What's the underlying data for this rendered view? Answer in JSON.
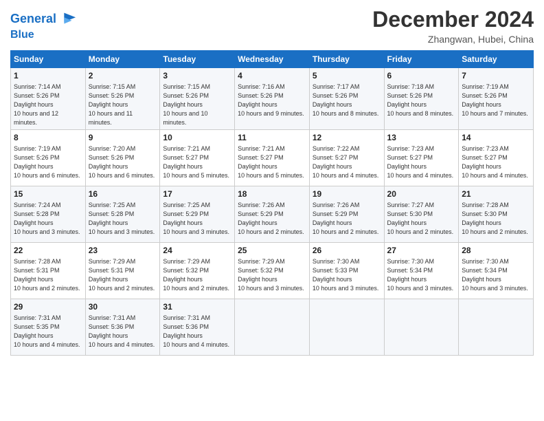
{
  "header": {
    "logo_line1": "General",
    "logo_line2": "Blue",
    "month": "December 2024",
    "location": "Zhangwan, Hubei, China"
  },
  "weekdays": [
    "Sunday",
    "Monday",
    "Tuesday",
    "Wednesday",
    "Thursday",
    "Friday",
    "Saturday"
  ],
  "weeks": [
    [
      {
        "day": "1",
        "sunrise": "7:14 AM",
        "sunset": "5:26 PM",
        "daylight": "10 hours and 12 minutes."
      },
      {
        "day": "2",
        "sunrise": "7:15 AM",
        "sunset": "5:26 PM",
        "daylight": "10 hours and 11 minutes."
      },
      {
        "day": "3",
        "sunrise": "7:15 AM",
        "sunset": "5:26 PM",
        "daylight": "10 hours and 10 minutes."
      },
      {
        "day": "4",
        "sunrise": "7:16 AM",
        "sunset": "5:26 PM",
        "daylight": "10 hours and 9 minutes."
      },
      {
        "day": "5",
        "sunrise": "7:17 AM",
        "sunset": "5:26 PM",
        "daylight": "10 hours and 8 minutes."
      },
      {
        "day": "6",
        "sunrise": "7:18 AM",
        "sunset": "5:26 PM",
        "daylight": "10 hours and 8 minutes."
      },
      {
        "day": "7",
        "sunrise": "7:19 AM",
        "sunset": "5:26 PM",
        "daylight": "10 hours and 7 minutes."
      }
    ],
    [
      {
        "day": "8",
        "sunrise": "7:19 AM",
        "sunset": "5:26 PM",
        "daylight": "10 hours and 6 minutes."
      },
      {
        "day": "9",
        "sunrise": "7:20 AM",
        "sunset": "5:26 PM",
        "daylight": "10 hours and 6 minutes."
      },
      {
        "day": "10",
        "sunrise": "7:21 AM",
        "sunset": "5:27 PM",
        "daylight": "10 hours and 5 minutes."
      },
      {
        "day": "11",
        "sunrise": "7:21 AM",
        "sunset": "5:27 PM",
        "daylight": "10 hours and 5 minutes."
      },
      {
        "day": "12",
        "sunrise": "7:22 AM",
        "sunset": "5:27 PM",
        "daylight": "10 hours and 4 minutes."
      },
      {
        "day": "13",
        "sunrise": "7:23 AM",
        "sunset": "5:27 PM",
        "daylight": "10 hours and 4 minutes."
      },
      {
        "day": "14",
        "sunrise": "7:23 AM",
        "sunset": "5:27 PM",
        "daylight": "10 hours and 4 minutes."
      }
    ],
    [
      {
        "day": "15",
        "sunrise": "7:24 AM",
        "sunset": "5:28 PM",
        "daylight": "10 hours and 3 minutes."
      },
      {
        "day": "16",
        "sunrise": "7:25 AM",
        "sunset": "5:28 PM",
        "daylight": "10 hours and 3 minutes."
      },
      {
        "day": "17",
        "sunrise": "7:25 AM",
        "sunset": "5:29 PM",
        "daylight": "10 hours and 3 minutes."
      },
      {
        "day": "18",
        "sunrise": "7:26 AM",
        "sunset": "5:29 PM",
        "daylight": "10 hours and 2 minutes."
      },
      {
        "day": "19",
        "sunrise": "7:26 AM",
        "sunset": "5:29 PM",
        "daylight": "10 hours and 2 minutes."
      },
      {
        "day": "20",
        "sunrise": "7:27 AM",
        "sunset": "5:30 PM",
        "daylight": "10 hours and 2 minutes."
      },
      {
        "day": "21",
        "sunrise": "7:28 AM",
        "sunset": "5:30 PM",
        "daylight": "10 hours and 2 minutes."
      }
    ],
    [
      {
        "day": "22",
        "sunrise": "7:28 AM",
        "sunset": "5:31 PM",
        "daylight": "10 hours and 2 minutes."
      },
      {
        "day": "23",
        "sunrise": "7:29 AM",
        "sunset": "5:31 PM",
        "daylight": "10 hours and 2 minutes."
      },
      {
        "day": "24",
        "sunrise": "7:29 AM",
        "sunset": "5:32 PM",
        "daylight": "10 hours and 2 minutes."
      },
      {
        "day": "25",
        "sunrise": "7:29 AM",
        "sunset": "5:32 PM",
        "daylight": "10 hours and 3 minutes."
      },
      {
        "day": "26",
        "sunrise": "7:30 AM",
        "sunset": "5:33 PM",
        "daylight": "10 hours and 3 minutes."
      },
      {
        "day": "27",
        "sunrise": "7:30 AM",
        "sunset": "5:34 PM",
        "daylight": "10 hours and 3 minutes."
      },
      {
        "day": "28",
        "sunrise": "7:30 AM",
        "sunset": "5:34 PM",
        "daylight": "10 hours and 3 minutes."
      }
    ],
    [
      {
        "day": "29",
        "sunrise": "7:31 AM",
        "sunset": "5:35 PM",
        "daylight": "10 hours and 4 minutes."
      },
      {
        "day": "30",
        "sunrise": "7:31 AM",
        "sunset": "5:36 PM",
        "daylight": "10 hours and 4 minutes."
      },
      {
        "day": "31",
        "sunrise": "7:31 AM",
        "sunset": "5:36 PM",
        "daylight": "10 hours and 4 minutes."
      },
      null,
      null,
      null,
      null
    ]
  ],
  "labels": {
    "sunrise": "Sunrise:",
    "sunset": "Sunset:",
    "daylight": "Daylight hours"
  }
}
